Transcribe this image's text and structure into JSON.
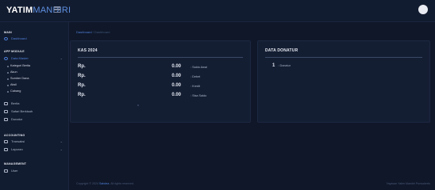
{
  "brand": {
    "part1": "YATIM",
    "part2": "MANDIRI"
  },
  "sidebar": {
    "sections": {
      "main": "MAIN",
      "app": "APP MODULE",
      "accounting": "ACCOUNTING",
      "management": "MANAGEMENT"
    },
    "items": {
      "dashboard": "Dashboard",
      "data_master": "Data Master",
      "kategori_berita": "Kategori Berita",
      "akun": "Akun",
      "sumber_dana": "Sumber Dana",
      "aksi": "Aksil",
      "cabang": "Cabang",
      "berita": "Berita",
      "safari_berkisah": "Safari Berkisah",
      "donatur": "Donatur",
      "transaksi": "Transaksi",
      "laporan": "Laporan",
      "user": "User"
    }
  },
  "breadcrumb": {
    "first": "Dashboard",
    "sep": " / ",
    "second": "Dashboard"
  },
  "kas": {
    "title": "KAS 2024",
    "rows": [
      {
        "currency": "Rp.",
        "value": "0.00",
        "label": ": Saldo Awal"
      },
      {
        "currency": "Rp.",
        "value": "0.00",
        "label": ": Debet"
      },
      {
        "currency": "Rp.",
        "value": "0.00",
        "label": ": Kredit"
      },
      {
        "currency": "Rp.",
        "value": "0.00",
        "label": ": Sisa Saldo"
      }
    ]
  },
  "donatur": {
    "title": "DATA DONATUR",
    "count": "1",
    "label": ": Donatur"
  },
  "footer": {
    "left_prefix": "Copyright © 2024",
    "left_link": "Sabdea",
    "left_suffix": ". All rights reserved.",
    "right": "Yayasan Yatim Mandiri Purwokerto"
  },
  "colors": {
    "accent": "#4f7fd8",
    "background": "#0f1729",
    "card": "#141e33"
  }
}
